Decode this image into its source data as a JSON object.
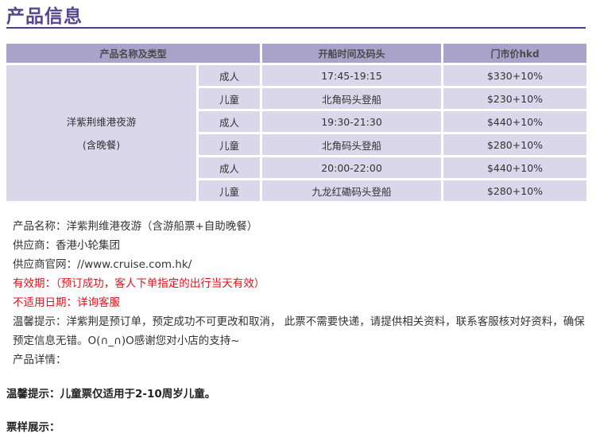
{
  "page_title": "产品信息",
  "table": {
    "headers": [
      "产品名称及类型",
      "开船时间及码头",
      "门市价hkd"
    ],
    "product_name_line1": "洋紫荆维港夜游",
    "product_name_line2": "(含晚餐)",
    "rows": [
      {
        "type": "成人",
        "time": "17:45-19:15",
        "price": "$330+10%"
      },
      {
        "type": "儿童",
        "time": "北角码头登船",
        "price": "$230+10%"
      },
      {
        "type": "成人",
        "time": "19:30-21:30",
        "price": "$440+10%"
      },
      {
        "type": "儿童",
        "time": "北角码头登船",
        "price": "$280+10%"
      },
      {
        "type": "成人",
        "time": "20:00-22:00",
        "price": "$440+10%"
      },
      {
        "type": "儿童",
        "time": "九龙红磡码头登船",
        "price": "$280+10%"
      }
    ]
  },
  "info": {
    "product_name": "产品名称：洋紫荆维港夜游（含游船票+自助晚餐）",
    "supplier": "供应商：香港小轮集团",
    "website": "供应商官网：//www.cruise.com.hk/",
    "validity": "有效期：（预订成功，客人下单指定的出行当天有效）",
    "not_applicable": "不适用日期：详询客服",
    "tips": "温馨提示：洋紫荆是预订单，预定成功不可更改和取消， 此票不需要快递，请提供相关资料，联系客服核对好资料，确保预定信息无错。O(∩_∩)O感谢您对小店的支持~",
    "details": "产品详情："
  },
  "notice": "温馨提示：儿童票仅适用于2-10周岁儿童。",
  "ticket_sample": "票样展示："
}
